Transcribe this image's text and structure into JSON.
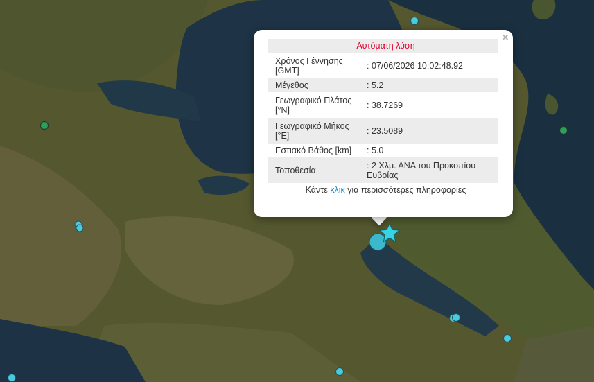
{
  "popup": {
    "title": "Αυτόματη λύση",
    "close_label": "×",
    "rows": [
      {
        "label": "Χρόνος Γέννησης [GMT]",
        "value": ": 07/06/2026 10:02:48.92"
      },
      {
        "label": "Μέγεθος",
        "value": ": 5.2"
      },
      {
        "label": "Γεωγραφικό Πλάτος [°N]",
        "value": ": 38.7269"
      },
      {
        "label": "Γεωγραφικό Μήκος [°E]",
        "value": ": 23.5089"
      },
      {
        "label": "Εστιακό Βάθος [km]",
        "value": ": 5.0"
      },
      {
        "label": "Τοποθεσία",
        "value": ": 2 Χλμ. ΑΝΑ του Προκοπίου Ευβοίας"
      }
    ],
    "footer_before": "Κάντε ",
    "footer_link": "κλικ",
    "footer_after": " για περισσότερες πληροφορίες"
  },
  "markers": {
    "epicenter_icon": "star-icon",
    "epicenter_color": "#33d6e8",
    "cyan_color": "#4cc9dc",
    "green_color": "#2e9e5b"
  }
}
